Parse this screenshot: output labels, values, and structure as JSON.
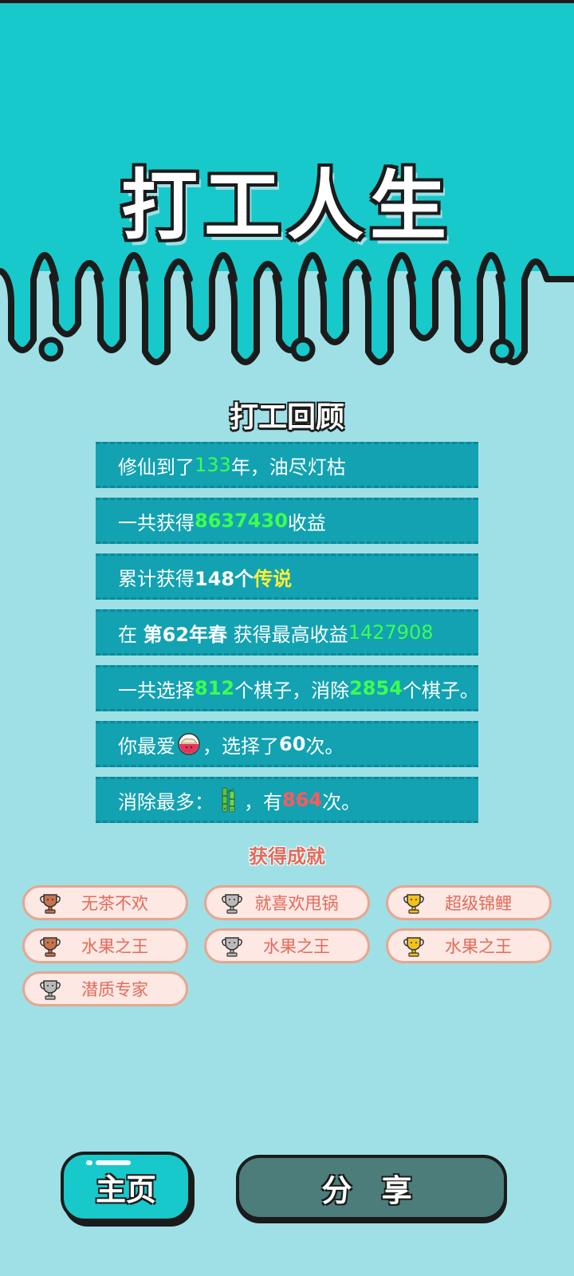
{
  "app": {
    "title": "打工人生"
  },
  "review": {
    "title": "打工回顾",
    "rows": [
      {
        "a": "修仙到了",
        "b": "133",
        "c": "年，油尽灯枯"
      },
      {
        "a": "一共获得",
        "b": "8637430",
        "c": "收益"
      },
      {
        "a": "累计获得",
        "b": "148个",
        "c": "传说"
      },
      {
        "a": "在 ",
        "b": "第62年春",
        "c": " 获得最高收益",
        "d": "1427908"
      },
      {
        "a": "一共选择",
        "b": "812",
        "c": "个棋子，消除",
        "d": "2854",
        "e": "个棋子。"
      },
      {
        "a": "你最爱",
        "icon": "dish-icon",
        "c": "，选择了",
        "d": "60",
        "e": "次。"
      },
      {
        "a": "消除最多：",
        "icon": "bamboo-icon",
        "c": "，有",
        "d": "864",
        "e": "次。"
      }
    ]
  },
  "achievements": {
    "title": "获得成就",
    "items": [
      {
        "label": "无茶不欢",
        "tier": "bronze",
        "icon": "bronze-trophy-icon"
      },
      {
        "label": "就喜欢甩锅",
        "tier": "silver",
        "icon": "silver-trophy-icon"
      },
      {
        "label": "超级锦鲤",
        "tier": "gold",
        "icon": "gold-trophy-icon"
      },
      {
        "label": "水果之王",
        "tier": "bronze",
        "icon": "bronze-trophy-icon"
      },
      {
        "label": "水果之王",
        "tier": "silver",
        "icon": "silver-trophy-icon"
      },
      {
        "label": "水果之王",
        "tier": "gold",
        "icon": "gold-trophy-icon"
      },
      {
        "label": "潜质专家",
        "tier": "silver",
        "icon": "silver-trophy-icon"
      }
    ]
  },
  "buttons": {
    "home": "主页",
    "share": "分 享"
  },
  "colors": {
    "top_bg": "#17c9cb",
    "body_bg": "#9fe0e6",
    "row_bg": "#12a2b2",
    "highlight_green": "#3dff4e",
    "highlight_yellow": "#ffee33",
    "highlight_red": "#ff5a5a",
    "badge_bg": "#fde8e3",
    "badge_text": "#e36a5a",
    "bronze": "#c8734c",
    "silver": "#b9b9b9",
    "gold": "#f2c21b",
    "share_bg": "#4c7d7a"
  }
}
